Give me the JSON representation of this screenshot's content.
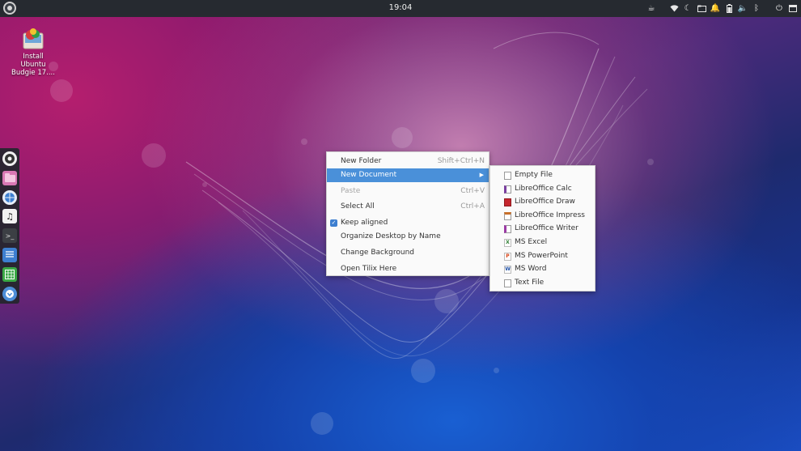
{
  "panel": {
    "clock": "19:04"
  },
  "desktop_icon": {
    "label_line1": "Install",
    "label_line2": "Ubuntu",
    "label_line3": "Budgie 17...."
  },
  "dock": {
    "items": [
      "settings-icon",
      "files-icon",
      "browser-icon",
      "music-icon",
      "terminal-icon",
      "text-editor-icon",
      "spreadsheet-icon",
      "software-icon"
    ]
  },
  "context_menu": {
    "new_folder": "New Folder",
    "new_folder_accel": "Shift+Ctrl+N",
    "new_document": "New Document",
    "paste": "Paste",
    "paste_accel": "Ctrl+V",
    "select_all": "Select All",
    "select_all_accel": "Ctrl+A",
    "keep_aligned": "Keep aligned",
    "organize": "Organize Desktop by Name",
    "change_background": "Change Background",
    "open_tilix": "Open Tilix Here"
  },
  "submenu": {
    "items": [
      {
        "label": "Empty File",
        "icon": "empty-file-icon",
        "color": "#ffffff"
      },
      {
        "label": "LibreOffice Calc",
        "icon": "calc-icon",
        "color": "#7a3fa0"
      },
      {
        "label": "LibreOffice Draw",
        "icon": "draw-icon",
        "color": "#c6262e"
      },
      {
        "label": "LibreOffice Impress",
        "icon": "impress-icon",
        "color": "#c8702a"
      },
      {
        "label": "LibreOffice Writer",
        "icon": "writer-icon",
        "color": "#9b3aa5"
      },
      {
        "label": "MS Excel",
        "icon": "excel-icon",
        "color": "#2e7d32"
      },
      {
        "label": "MS PowerPoint",
        "icon": "powerpoint-icon",
        "color": "#d84315"
      },
      {
        "label": "MS Word",
        "icon": "word-icon",
        "color": "#1e4fa5"
      },
      {
        "label": "Text File",
        "icon": "text-file-icon",
        "color": "#ffffff"
      }
    ]
  }
}
